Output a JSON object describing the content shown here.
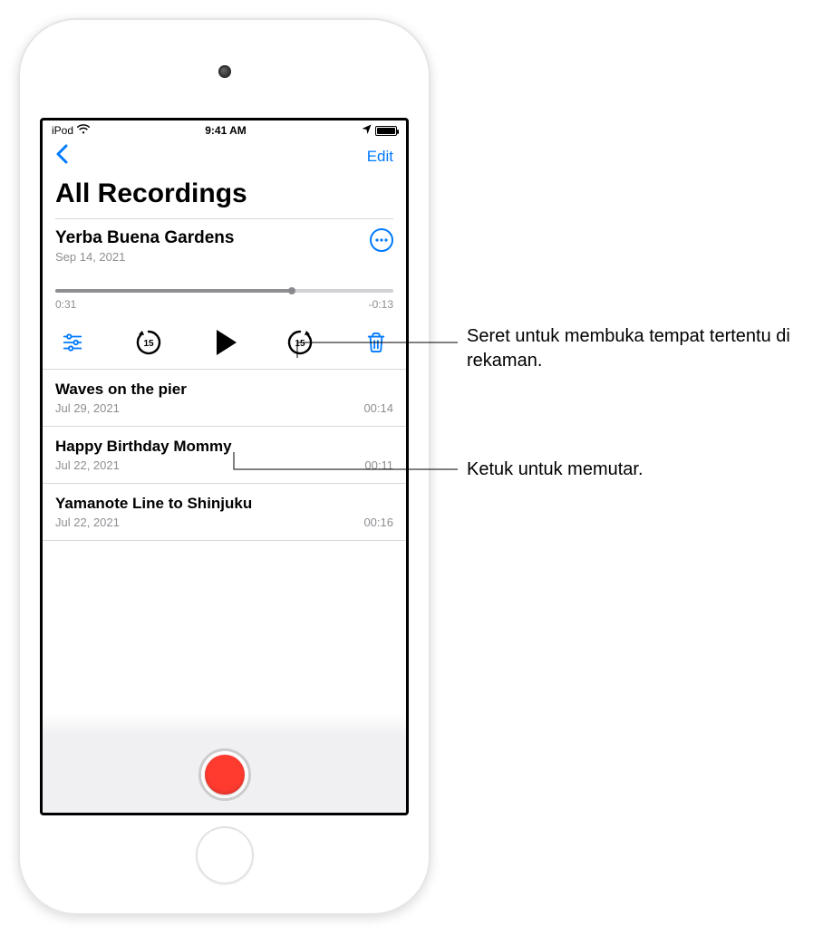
{
  "statusbar": {
    "carrier": "iPod",
    "time": "9:41 AM"
  },
  "nav": {
    "edit_label": "Edit"
  },
  "page": {
    "title": "All Recordings"
  },
  "expanded": {
    "title": "Yerba Buena Gardens",
    "date": "Sep 14, 2021",
    "elapsed": "0:31",
    "remaining": "-0:13",
    "skip_seconds": "15"
  },
  "recordings": [
    {
      "title": "Waves on the pier",
      "date": "Jul 29, 2021",
      "duration": "00:14"
    },
    {
      "title": "Happy Birthday Mommy",
      "date": "Jul 22, 2021",
      "duration": "00:11"
    },
    {
      "title": "Yamanote Line to Shinjuku",
      "date": "Jul 22, 2021",
      "duration": "00:16"
    }
  ],
  "callouts": {
    "scrubber": "Seret untuk membuka tempat tertentu di rekaman.",
    "play": "Ketuk untuk memutar."
  }
}
